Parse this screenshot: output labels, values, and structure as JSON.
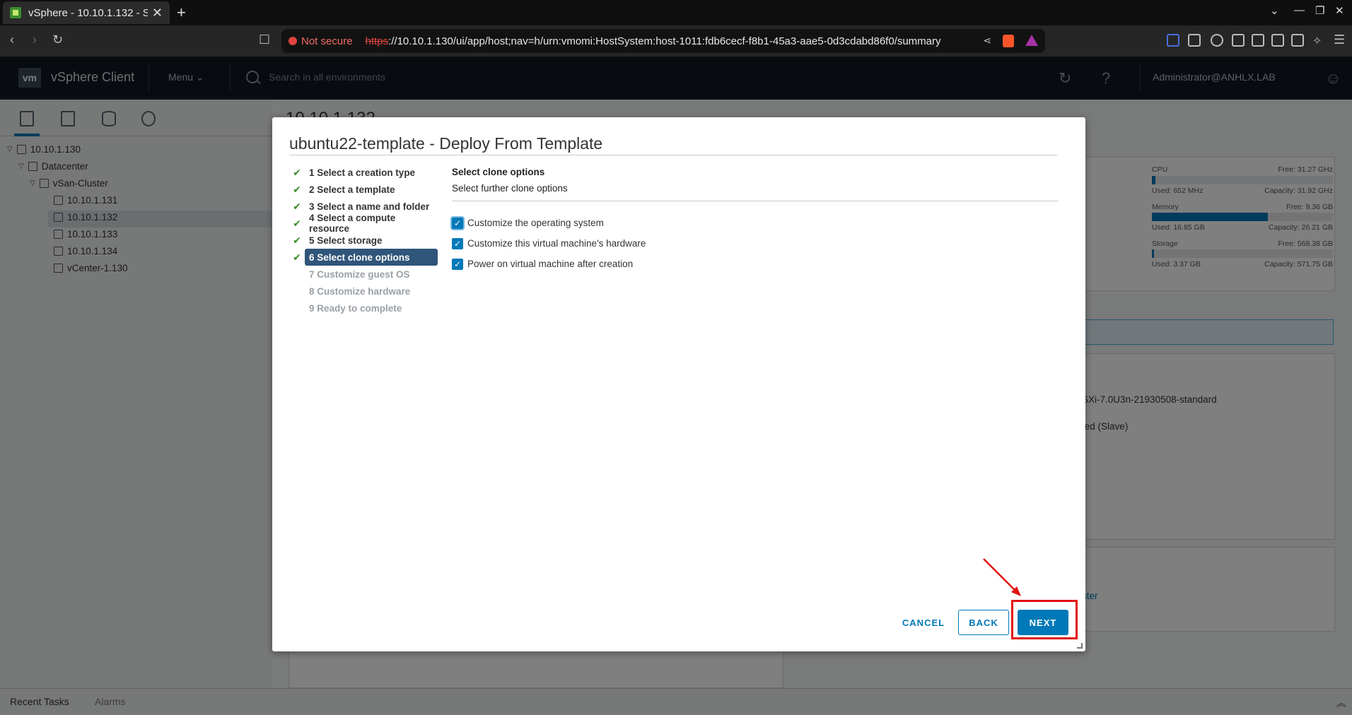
{
  "browser": {
    "tab_title": "vSphere - 10.10.1.132 - S",
    "not_secure": "Not secure",
    "url_scheme": "https",
    "url_rest": "://10.10.1.130/ui/app/host;nav=h/urn:vmomi:HostSystem:host-1011:fdb6cecf-f8b1-45a3-aae5-0d3cdabd86f0/summary"
  },
  "header": {
    "logo": "vm",
    "product": "vSphere Client",
    "menu": "Menu",
    "search_placeholder": "Search in all environments",
    "user": "Administrator@ANHLX.LAB"
  },
  "tree": {
    "items": [
      {
        "label": "10.10.1.130"
      },
      {
        "label": "Datacenter"
      },
      {
        "label": "vSan-Cluster"
      },
      {
        "label": "10.10.1.131"
      },
      {
        "label": "10.10.1.132"
      },
      {
        "label": "10.10.1.133"
      },
      {
        "label": "10.10.1.134"
      },
      {
        "label": "vCenter-1.130"
      }
    ]
  },
  "background": {
    "page_title": "10.10.1.132",
    "cpu_label": "CPU",
    "cpu_free": "Free: 31.27 GHz",
    "cpu_used": "Used: 652 MHz",
    "cpu_capacity": "Capacity: 31.92 GHz",
    "cpu_fraction": 0.02,
    "mem_label": "Memory",
    "mem_free": "Free: 9.36 GB",
    "mem_used": "Used: 16.85 GB",
    "mem_capacity": "Capacity: 26.21 GB",
    "mem_fraction": 0.64,
    "storage_label": "Storage",
    "storage_free": "Free: 568.38 GB",
    "storage_used": "Used: 3.37 GB",
    "storage_capacity": "Capacity: 571.75 GB",
    "storage_fraction": 0.006,
    "row1": "SXi-7.0U3n-21930508-standard",
    "row2": "ted (Slave)",
    "link": "ster"
  },
  "bottom": {
    "recent_tasks": "Recent Tasks",
    "alarms": "Alarms"
  },
  "modal": {
    "title": "ubuntu22-template - Deploy From Template",
    "steps": [
      {
        "label": "1 Select a creation type"
      },
      {
        "label": "2 Select a template"
      },
      {
        "label": "3 Select a name and folder"
      },
      {
        "label": "4 Select a compute resource"
      },
      {
        "label": "5 Select storage"
      },
      {
        "label": "6 Select clone options"
      },
      {
        "label": "7 Customize guest OS"
      },
      {
        "label": "8 Customize hardware"
      },
      {
        "label": "9 Ready to complete"
      }
    ],
    "content_title": "Select clone options",
    "content_subtitle": "Select further clone options",
    "options": [
      {
        "label": "Customize the operating system",
        "checked": true
      },
      {
        "label": "Customize this virtual machine's hardware",
        "checked": true
      },
      {
        "label": "Power on virtual machine after creation",
        "checked": true
      }
    ],
    "cancel": "CANCEL",
    "back": "BACK",
    "next": "NEXT"
  },
  "colors": {
    "accent": "#0079b8",
    "active_step": "#30557a",
    "check_green": "#3b8d2b",
    "annotation_red": "#e0110f"
  }
}
